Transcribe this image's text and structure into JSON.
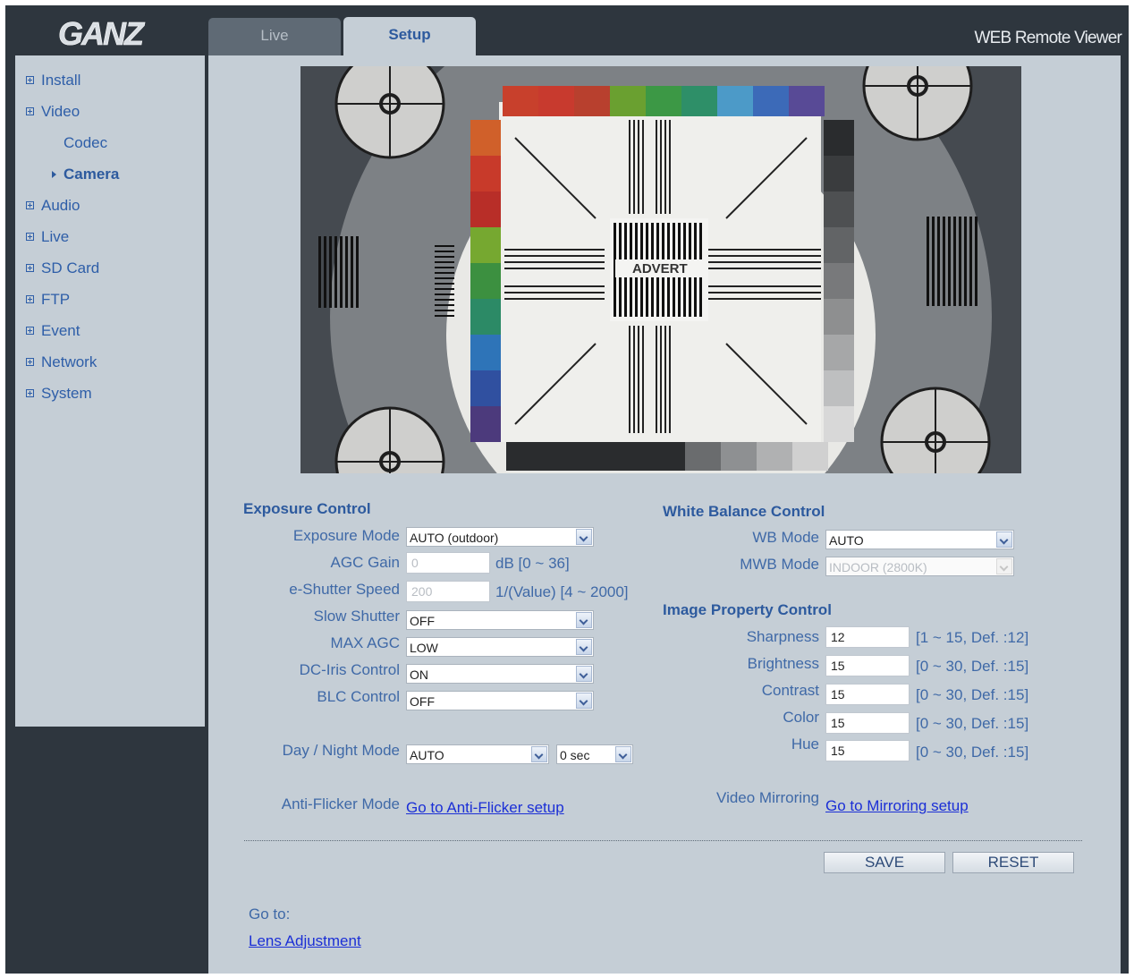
{
  "header": {
    "logo_text": "GANZ",
    "viewer_title": "WEB Remote Viewer",
    "tabs": [
      {
        "label": "Live"
      },
      {
        "label": "Setup"
      }
    ]
  },
  "sidebar": {
    "items": [
      {
        "label": "Install"
      },
      {
        "label": "Video"
      },
      {
        "label": "Codec"
      },
      {
        "label": "Camera"
      },
      {
        "label": "Audio"
      },
      {
        "label": "Live"
      },
      {
        "label": "SD Card"
      },
      {
        "label": "FTP"
      },
      {
        "label": "Event"
      },
      {
        "label": "Network"
      },
      {
        "label": "System"
      }
    ]
  },
  "exposure": {
    "title": "Exposure Control",
    "exposure_mode": {
      "label": "Exposure Mode",
      "value": "AUTO (outdoor)"
    },
    "agc_gain": {
      "label": "AGC Gain",
      "value": "0",
      "hint": "dB [0 ~ 36]"
    },
    "shutter": {
      "label": "e-Shutter Speed",
      "value": "200",
      "hint": "1/(Value) [4 ~ 2000]"
    },
    "slow_shutter": {
      "label": "Slow Shutter",
      "value": "OFF"
    },
    "max_agc": {
      "label": "MAX AGC",
      "value": "LOW"
    },
    "dc_iris": {
      "label": "DC-Iris Control",
      "value": "ON"
    },
    "blc": {
      "label": "BLC Control",
      "value": "OFF"
    },
    "day_night": {
      "label": "Day / Night Mode",
      "value": "AUTO",
      "delay": "0 sec"
    },
    "anti_flicker": {
      "label": "Anti-Flicker Mode",
      "link": "Go to Anti-Flicker setup"
    }
  },
  "white_balance": {
    "title": "White Balance Control",
    "wb_mode": {
      "label": "WB Mode",
      "value": "AUTO"
    },
    "mwb_mode": {
      "label": "MWB Mode",
      "value": "INDOOR (2800K)"
    }
  },
  "image_property": {
    "title": "Image Property Control",
    "sharpness": {
      "label": "Sharpness",
      "value": "12",
      "hint": "[1 ~ 15, Def. :12]"
    },
    "brightness": {
      "label": "Brightness",
      "value": "15",
      "hint": "[0 ~ 30, Def. :15]"
    },
    "contrast": {
      "label": "Contrast",
      "value": "15",
      "hint": "[0 ~ 30, Def. :15]"
    },
    "color": {
      "label": "Color",
      "value": "15",
      "hint": "[0 ~ 30, Def. :15]"
    },
    "hue": {
      "label": "Hue",
      "value": "15",
      "hint": "[0 ~ 30, Def. :15]"
    },
    "mirroring": {
      "label": "Video Mirroring",
      "link": "Go to Mirroring setup"
    }
  },
  "buttons": {
    "save": "SAVE",
    "reset": "RESET"
  },
  "goto": {
    "label": "Go to:",
    "link": "Lens Adjustment"
  },
  "colors": {
    "background": "#2e363e",
    "panel": "#c5ced6",
    "accent": "#2d5a9e",
    "link": "#1b2fd6"
  }
}
